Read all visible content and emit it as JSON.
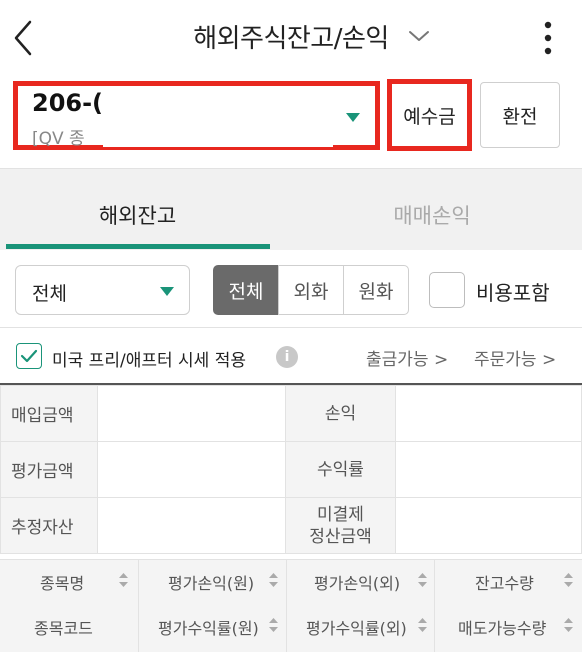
{
  "header": {
    "title": "해외주식잔고/손익"
  },
  "account": {
    "number": "206-(",
    "type": "[QV 종"
  },
  "buttons": {
    "deposit": "예수금",
    "exchange": "환전"
  },
  "tabs": [
    {
      "label": "해외잔고",
      "active": true
    },
    {
      "label": "매매손익",
      "active": false
    }
  ],
  "filter": {
    "selected": "전체",
    "segments": [
      "전체",
      "외화",
      "원화"
    ],
    "include_fees": "비용포함"
  },
  "options": {
    "us_pre_after": "미국 프리/애프터 시세 적용",
    "withdrawable": "출금가능 >",
    "orderable": "주문가능 >"
  },
  "summary": {
    "rows": [
      {
        "left_label": "매입금액",
        "right_label": "손익"
      },
      {
        "left_label": "평가금액",
        "right_label": "수익률"
      },
      {
        "left_label": "추정자산",
        "right_label_line1": "미결제",
        "right_label_line2": "정산금액"
      }
    ]
  },
  "columns": {
    "row1": [
      "종목명",
      "평가손익(원)",
      "평가손익(외)",
      "잔고수량"
    ],
    "row2": [
      "종목코드",
      "평가수익률(원)",
      "평가수익률(외)",
      "매도가능수량"
    ]
  },
  "colors": {
    "accent": "#1a9479",
    "highlight_box": "#e8281f",
    "segment_active": "#6a6a6a"
  }
}
